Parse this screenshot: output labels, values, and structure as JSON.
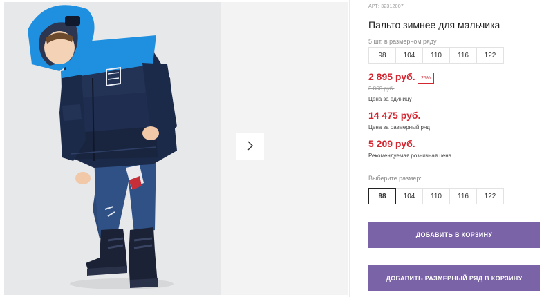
{
  "product": {
    "sku": "АРТ: 32312007",
    "title": "Пальто зимнее для мальчика",
    "set_note": "5 шт. в размерном ряду",
    "sizes": [
      "98",
      "104",
      "110",
      "116",
      "122"
    ],
    "selected_size": "98"
  },
  "pricing": {
    "unit_price": "2 895 руб.",
    "discount": "25%",
    "old_price": "3 860 руб.",
    "unit_label": "Цена за единицу",
    "set_price": "14 475 руб.",
    "set_label": "Цена за размерный ряд",
    "retail_price": "5 209 руб.",
    "retail_label": "Рекомендуемая розничная цена"
  },
  "selector": {
    "label": "Выберите размер:"
  },
  "actions": {
    "add_to_cart": "ДОБАВИТЬ В КОРЗИНУ",
    "add_set_to_cart": "ДОБАВИТЬ РАЗМЕРНЫЙ РЯД В КОРЗИНУ"
  },
  "colors": {
    "price_red": "#d42631",
    "button_purple": "#7a63a6",
    "jacket_navy": "#1c2a4a",
    "jacket_blue": "#1f8fe0"
  },
  "icons": {
    "gallery_next": "chevron-right-icon"
  }
}
